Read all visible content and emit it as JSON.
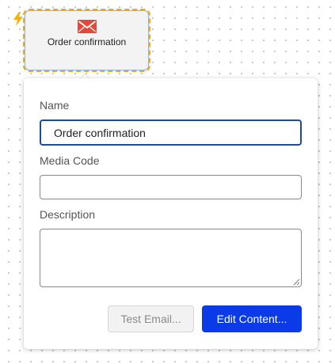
{
  "node": {
    "label": "Order confirmation",
    "icon": "envelope-icon",
    "trigger_icon": "lightning-icon",
    "border_color": "#f2a80f"
  },
  "form": {
    "name_label": "Name",
    "name_value": "Order confirmation",
    "media_code_label": "Media Code",
    "media_code_value": "",
    "description_label": "Description",
    "description_value": ""
  },
  "buttons": {
    "test_email": "Test Email...",
    "edit_content": "Edit Content..."
  },
  "colors": {
    "primary": "#0b3be8",
    "focus": "#1d4b9b",
    "accent": "#f2a80f"
  }
}
